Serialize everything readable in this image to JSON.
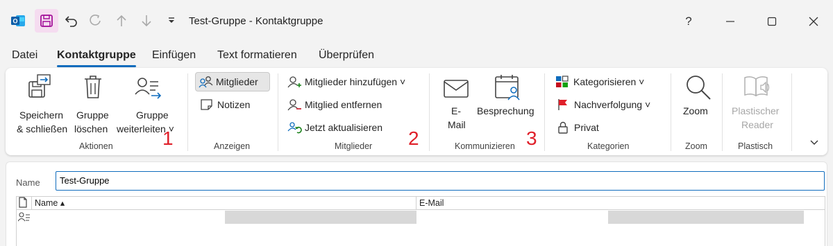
{
  "window": {
    "title": "Test-Gruppe  -  Kontaktgruppe",
    "help": "?",
    "app_icon_letter": "O"
  },
  "tabs": [
    {
      "label": "Datei"
    },
    {
      "label": "Kontaktgruppe",
      "active": true
    },
    {
      "label": "Einfügen"
    },
    {
      "label": "Text formatieren"
    },
    {
      "label": "Überprüfen"
    }
  ],
  "ribbon": {
    "aktionen": {
      "save_close": [
        "Speichern",
        "& schließen"
      ],
      "delete_group": [
        "Gruppe",
        "löschen"
      ],
      "forward_group": [
        "Gruppe",
        "weiterleiten ˅"
      ],
      "group_label": "Aktionen",
      "annotation": "1"
    },
    "anzeigen": {
      "members": "Mitglieder",
      "notes": "Notizen",
      "group_label": "Anzeigen"
    },
    "mitglieder": {
      "add_members": "Mitglieder hinzufügen ˅",
      "remove_member": "Mitglied entfernen",
      "update_now": "Jetzt aktualisieren",
      "group_label": "Mitglieder",
      "annotation": "2"
    },
    "kommunizieren": {
      "email": [
        "E-",
        "Mail"
      ],
      "meeting": "Besprechung",
      "group_label": "Kommunizieren",
      "annotation": "3"
    },
    "kategorien": {
      "categorize": "Kategorisieren ˅",
      "followup": "Nachverfolgung ˅",
      "private": "Privat",
      "group_label": "Kategorien"
    },
    "zoom": {
      "zoom": "Zoom",
      "group_label": "Zoom"
    },
    "plastisch": {
      "reader": [
        "Plastischer",
        "Reader"
      ],
      "group_label": "Plastisch"
    }
  },
  "form": {
    "name_label": "Name",
    "name_value": "Test-Gruppe",
    "columns": {
      "name": "Name ▴",
      "email": "E-Mail"
    }
  },
  "colors": {
    "accent": "#0f6cbd",
    "save_icon": "#a4129a",
    "annotation": "#e0202a"
  }
}
